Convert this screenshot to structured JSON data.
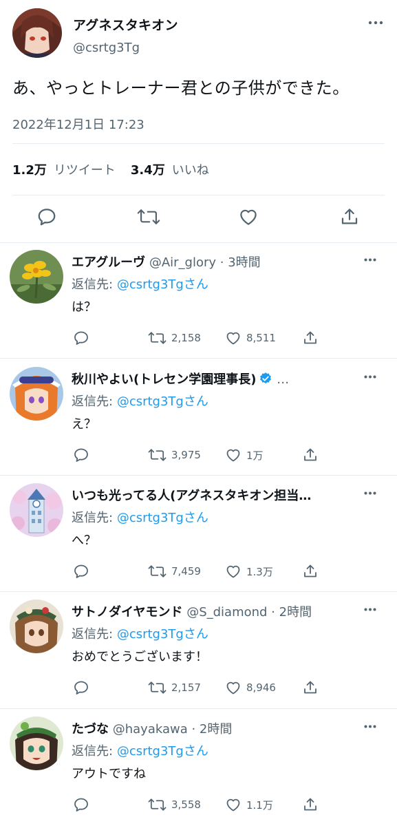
{
  "main_tweet": {
    "name": "アグネスタキオン",
    "handle": "@csrtg3Tg",
    "text": "あ、やっとトレーナー君との子供ができた。",
    "timestamp": "2022年12月1日 17:23",
    "retweets_count": "1.2万",
    "retweets_label": "リツイート",
    "likes_count": "3.4万",
    "likes_label": "いいね"
  },
  "reply_to_label": "返信先:",
  "reply_to_mention": "@csrtg3Tgさん",
  "replies": [
    {
      "name": "エアグルーヴ",
      "meta": " @Air_glory · 3時間",
      "text": "は？",
      "retweets": "2,158",
      "likes": "8,511"
    },
    {
      "name": "秋川やよい(トレセン学園理事長)",
      "meta": " …",
      "verified": true,
      "text": "え？",
      "retweets": "3,975",
      "likes": "1万"
    },
    {
      "name": "いつも光ってる人(アグネスタキオン担当…",
      "meta": "",
      "text": "へ？",
      "retweets": "7,459",
      "likes": "1.3万"
    },
    {
      "name": "サトノダイヤモンド",
      "meta": " @S_diamond · 2時間",
      "text": "おめでとうございます！",
      "retweets": "2,157",
      "likes": "8,946"
    },
    {
      "name": "たづな",
      "meta": " @hayakawa · 2時間",
      "text": "アウトですね",
      "retweets": "3,558",
      "likes": "1.1万"
    }
  ],
  "icons": {
    "reply": "reply-icon",
    "retweet": "retweet-icon",
    "like": "heart-icon",
    "share": "share-icon",
    "more": "more-icon",
    "verified": "verified-badge-icon"
  },
  "colors": {
    "accent": "#1d9bf0",
    "secondary_text": "#536471",
    "primary_text": "#0f1419",
    "divider": "#e6ecf0"
  }
}
